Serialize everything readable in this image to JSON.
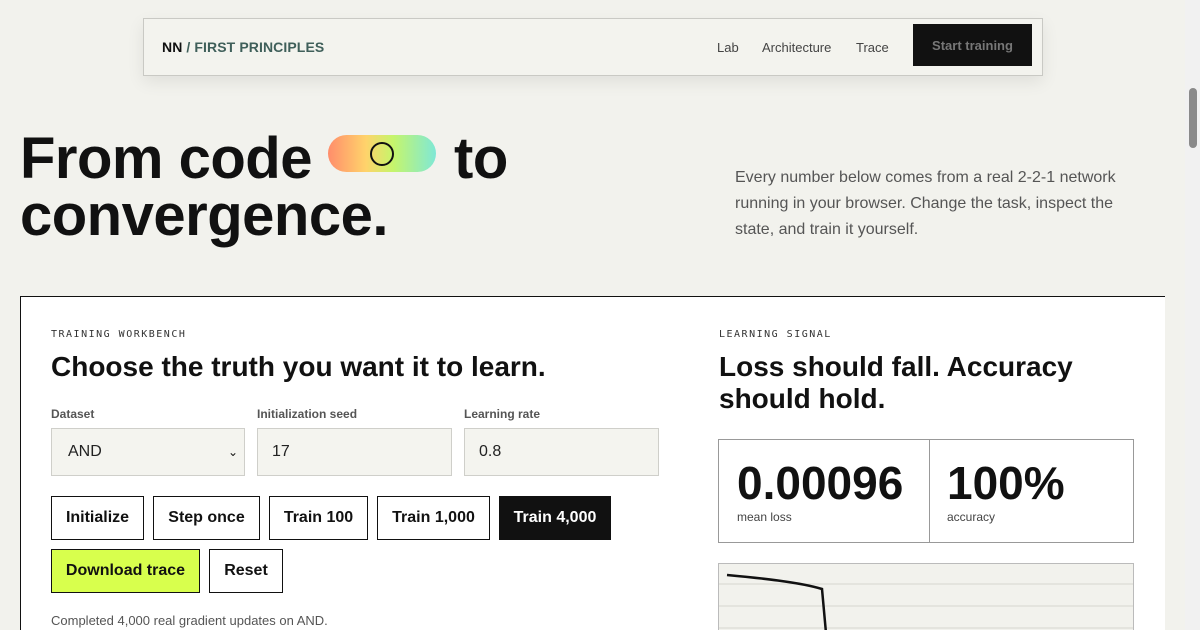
{
  "nav": {
    "brand_prefix": "NN",
    "brand_suffix": " / FIRST PRINCIPLES",
    "links": [
      "Lab",
      "Architecture",
      "Trace"
    ],
    "cta": "Start training"
  },
  "hero": {
    "line1_a": "From code",
    "line1_b": "to",
    "line2": "convergence.",
    "description": "Every number below comes from a real 2-2-1 network running in your browser. Change the task, inspect the state, and train it yourself."
  },
  "workbench": {
    "eyebrow": "TRAINING WORKBENCH",
    "heading": "Choose the truth you want it to learn.",
    "fields": {
      "dataset_label": "Dataset",
      "dataset_value": "AND",
      "seed_label": "Initialization seed",
      "seed_value": "17",
      "lr_label": "Learning rate",
      "lr_value": "0.8"
    },
    "buttons": {
      "initialize": "Initialize",
      "step_once": "Step once",
      "train_100": "Train 100",
      "train_1000": "Train 1,000",
      "train_4000": "Train 4,000",
      "download": "Download trace",
      "reset": "Reset"
    },
    "status": "Completed 4,000 real gradient updates on AND."
  },
  "signal": {
    "eyebrow": "LEARNING SIGNAL",
    "heading_line1": "Loss should fall. Accuracy",
    "heading_line2": "should hold.",
    "loss_value": "0.00096",
    "loss_label": "mean loss",
    "accuracy_value": "100%",
    "accuracy_label": "accuracy"
  },
  "colors": {
    "accent_lime": "#d8ff4d",
    "brand_teal": "#3f5f5a",
    "ink": "#111111"
  }
}
